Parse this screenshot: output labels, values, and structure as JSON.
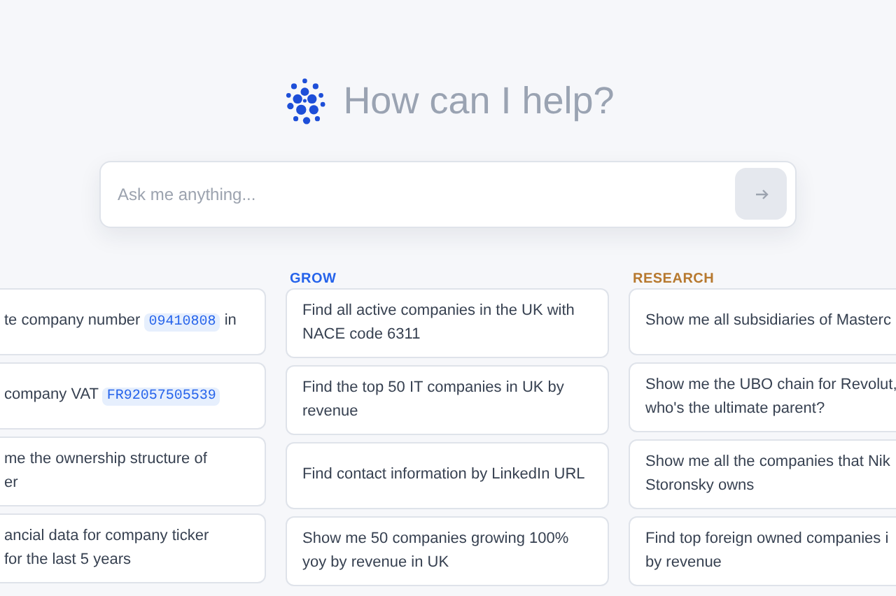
{
  "heading": "How can I help?",
  "search": {
    "placeholder": "Ask me anything..."
  },
  "columns": [
    {
      "kind": "cut_left",
      "cards": [
        {
          "lines": [
            [
              {
                "kind": "plain",
                "text": "te company number "
              },
              {
                "kind": "code",
                "text": "09410808"
              },
              {
                "kind": "plain",
                "text": " in"
              }
            ]
          ]
        },
        {
          "lines": [
            [
              {
                "kind": "plain",
                "text": "company VAT "
              },
              {
                "kind": "code",
                "text": "FR92057505539"
              }
            ]
          ]
        },
        {
          "lines": [
            [
              {
                "kind": "plain",
                "text": "me the ownership structure of"
              }
            ],
            [
              {
                "kind": "plain",
                "text": "er"
              }
            ]
          ]
        },
        {
          "lines": [
            [
              {
                "kind": "plain",
                "text": "ancial data for company ticker"
              }
            ],
            [
              {
                "kind": "plain",
                "text": "for the last 5 years"
              }
            ]
          ]
        }
      ]
    },
    {
      "kind": "full",
      "title": "GROW",
      "color": "#2563eb",
      "cards": [
        {
          "lines": [
            [
              {
                "kind": "plain",
                "text": "Find all active companies in the UK with"
              }
            ],
            [
              {
                "kind": "plain",
                "text": "NACE code 6311"
              }
            ]
          ]
        },
        {
          "lines": [
            [
              {
                "kind": "plain",
                "text": "Find the top 50 IT companies in UK by"
              }
            ],
            [
              {
                "kind": "plain",
                "text": "revenue"
              }
            ]
          ]
        },
        {
          "lines": [
            [
              {
                "kind": "plain",
                "text": "Find contact information by LinkedIn URL"
              }
            ]
          ]
        },
        {
          "lines": [
            [
              {
                "kind": "plain",
                "text": "Show me 50 companies growing 100%"
              }
            ],
            [
              {
                "kind": "plain",
                "text": "yoy by revenue in UK"
              }
            ]
          ]
        }
      ]
    },
    {
      "kind": "cut_right",
      "title": "RESEARCH",
      "color": "#b7792f",
      "cards": [
        {
          "lines": [
            [
              {
                "kind": "plain",
                "text": "Show me all subsidiaries of Masterc"
              }
            ]
          ]
        },
        {
          "lines": [
            [
              {
                "kind": "plain",
                "text": "Show me the UBO chain for Revolut,"
              }
            ],
            [
              {
                "kind": "plain",
                "text": "who's the ultimate parent?"
              }
            ]
          ]
        },
        {
          "lines": [
            [
              {
                "kind": "plain",
                "text": "Show me all the companies that Nik"
              }
            ],
            [
              {
                "kind": "plain",
                "text": "Storonsky owns"
              }
            ]
          ]
        },
        {
          "lines": [
            [
              {
                "kind": "plain",
                "text": "Find top foreign owned companies i"
              }
            ],
            [
              {
                "kind": "plain",
                "text": "by revenue"
              }
            ]
          ]
        }
      ]
    }
  ]
}
